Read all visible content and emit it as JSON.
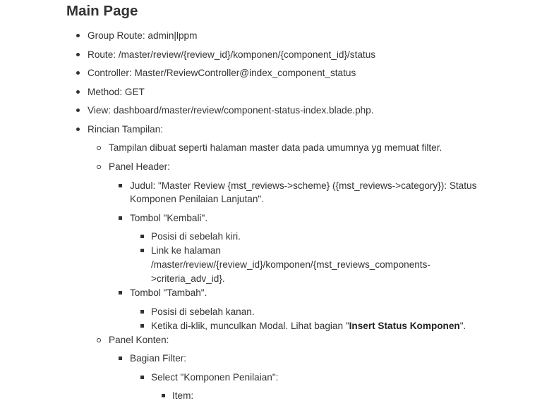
{
  "title": "Main Page",
  "items": {
    "group_route": "Group Route: admin|lppm",
    "route": "Route: /master/review/{review_id}/komponen/{component_id}/status",
    "controller": "Controller: Master/ReviewController@index_component_status",
    "method": "Method: GET",
    "view": "View: dashboard/master/review/component-status-index.blade.php.",
    "rincian": "Rincian Tampilan:"
  },
  "rincian": {
    "tampilan": "Tampilan dibuat seperti halaman master data pada umumnya yg memuat filter.",
    "panel_header": "Panel Header:",
    "judul_line1": "Judul: \"Master Review {mst_reviews->scheme} ({mst_reviews->category}): Status",
    "judul_line2": "Komponen Penilaian Lanjutan\".",
    "tombol_kembali": "Tombol \"Kembali\".",
    "kembali_posisi": "Posisi di sebelah kiri.",
    "kembali_link_1": "Link ke halaman",
    "kembali_link_2": "/master/review/{review_id}/komponen/{mst_reviews_components-",
    "kembali_link_3": ">criteria_adv_id}.",
    "tombol_tambah": "Tombol \"Tambah\".",
    "tambah_posisi": "Posisi di sebelah kanan.",
    "tambah_klik_prefix": "Ketika di-klik, munculkan Modal. Lihat bagian \"",
    "tambah_klik_bold": "Insert Status Komponen",
    "tambah_klik_suffix": "\".",
    "panel_konten": "Panel Konten:",
    "bagian_filter": "Bagian Filter:",
    "select_komponen": "Select \"Komponen Penilaian\":",
    "item": "Item:"
  }
}
